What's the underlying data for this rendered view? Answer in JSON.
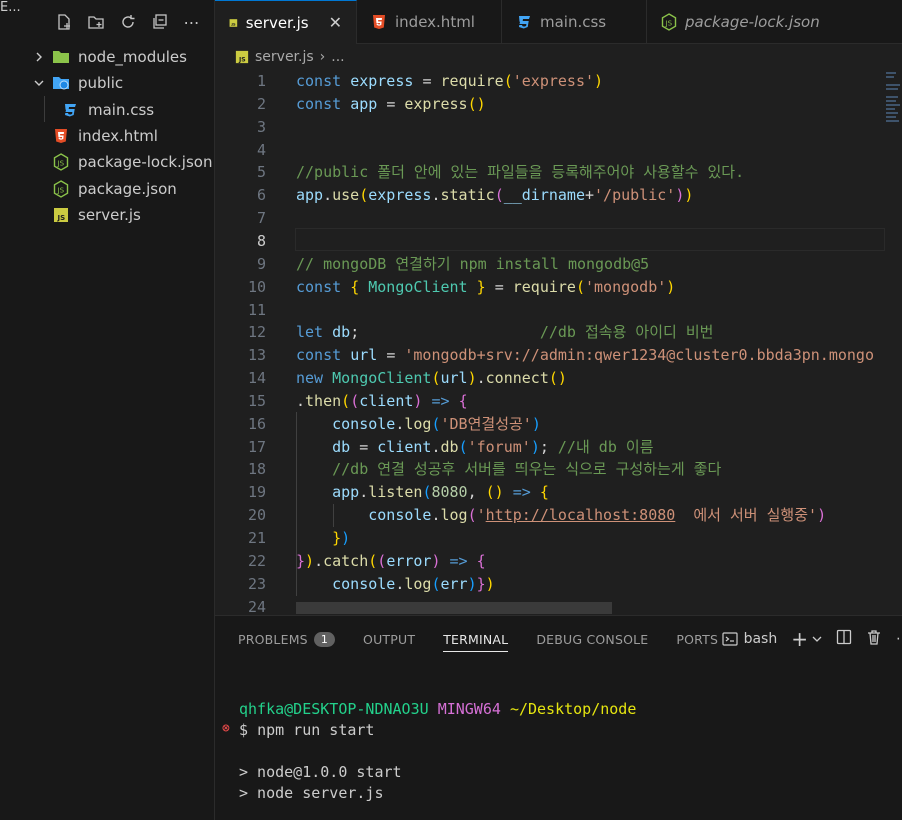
{
  "sidebar": {
    "title": "E...",
    "tree": [
      {
        "label": "node_modules",
        "type": "folder",
        "expanded": false
      },
      {
        "label": "public",
        "type": "folder",
        "expanded": true
      },
      {
        "label": "main.css",
        "type": "css"
      },
      {
        "label": "index.html",
        "type": "html"
      },
      {
        "label": "package-lock.json",
        "type": "json"
      },
      {
        "label": "package.json",
        "type": "json"
      },
      {
        "label": "server.js",
        "type": "js"
      }
    ]
  },
  "tabs": [
    {
      "label": "server.js",
      "active": true
    },
    {
      "label": "index.html",
      "active": false
    },
    {
      "label": "main.css",
      "active": false
    },
    {
      "label": "package-lock.json",
      "active": false
    }
  ],
  "breadcrumb": {
    "file": "server.js",
    "rest": "..."
  },
  "editor": {
    "current_line": 8,
    "lines": [
      {
        "n": "1",
        "tokens": [
          [
            "k",
            "const "
          ],
          [
            "v",
            "express "
          ],
          [
            "p",
            "= "
          ],
          [
            "f",
            "require"
          ],
          [
            "b1",
            "("
          ],
          [
            "s",
            "'express'"
          ],
          [
            "b1",
            ")"
          ]
        ]
      },
      {
        "n": "2",
        "tokens": [
          [
            "k",
            "const "
          ],
          [
            "v",
            "app "
          ],
          [
            "p",
            "= "
          ],
          [
            "f",
            "express"
          ],
          [
            "b1",
            "()"
          ]
        ]
      },
      {
        "n": "3",
        "tokens": []
      },
      {
        "n": "4",
        "tokens": []
      },
      {
        "n": "5",
        "tokens": [
          [
            "c",
            "//public 폴더 안에 있는 파일들을 등록해주어야 사용할수 있다."
          ]
        ]
      },
      {
        "n": "6",
        "tokens": [
          [
            "v",
            "app"
          ],
          [
            "p",
            "."
          ],
          [
            "f",
            "use"
          ],
          [
            "b1",
            "("
          ],
          [
            "v",
            "express"
          ],
          [
            "p",
            "."
          ],
          [
            "f",
            "static"
          ],
          [
            "b2",
            "("
          ],
          [
            "v",
            "__dirname"
          ],
          [
            "p",
            "+"
          ],
          [
            "s",
            "'/public'"
          ],
          [
            "b2",
            ")"
          ],
          [
            "b1",
            ")"
          ]
        ]
      },
      {
        "n": "7",
        "tokens": []
      },
      {
        "n": "8",
        "tokens": []
      },
      {
        "n": "9",
        "tokens": [
          [
            "c",
            "// mongoDB 연결하기 npm install mongodb@5"
          ]
        ]
      },
      {
        "n": "10",
        "tokens": [
          [
            "k",
            "const "
          ],
          [
            "b1",
            "{ "
          ],
          [
            "t",
            "MongoClient "
          ],
          [
            "b1",
            "} "
          ],
          [
            "p",
            "= "
          ],
          [
            "f",
            "require"
          ],
          [
            "b1",
            "("
          ],
          [
            "s",
            "'mongodb'"
          ],
          [
            "b1",
            ")"
          ]
        ]
      },
      {
        "n": "11",
        "tokens": []
      },
      {
        "n": "12",
        "tokens": [
          [
            "k",
            "let "
          ],
          [
            "v",
            "db"
          ],
          [
            "p",
            ";                    "
          ],
          [
            "c",
            "//db 접속용 아이디 비번"
          ]
        ]
      },
      {
        "n": "13",
        "tokens": [
          [
            "k",
            "const "
          ],
          [
            "v",
            "url "
          ],
          [
            "p",
            "= "
          ],
          [
            "s",
            "'mongodb+srv://admin:qwer1234@cluster0.bbda3pn.mongo"
          ]
        ]
      },
      {
        "n": "14",
        "tokens": [
          [
            "k",
            "new "
          ],
          [
            "t",
            "MongoClient"
          ],
          [
            "b1",
            "("
          ],
          [
            "v",
            "url"
          ],
          [
            "b1",
            ")"
          ],
          [
            "p",
            "."
          ],
          [
            "f",
            "connect"
          ],
          [
            "b1",
            "()"
          ]
        ]
      },
      {
        "n": "15",
        "tokens": [
          [
            "p",
            "."
          ],
          [
            "f",
            "then"
          ],
          [
            "b1",
            "("
          ],
          [
            "b2",
            "("
          ],
          [
            "v",
            "client"
          ],
          [
            "b2",
            ") "
          ],
          [
            "k",
            "=> "
          ],
          [
            "b2",
            "{"
          ]
        ]
      },
      {
        "n": "16",
        "tokens": [
          [
            "p",
            "    "
          ],
          [
            "v",
            "console"
          ],
          [
            "p",
            "."
          ],
          [
            "f",
            "log"
          ],
          [
            "b3",
            "("
          ],
          [
            "s",
            "'DB연결성공'"
          ],
          [
            "b3",
            ")"
          ]
        ]
      },
      {
        "n": "17",
        "tokens": [
          [
            "p",
            "    "
          ],
          [
            "v",
            "db "
          ],
          [
            "p",
            "= "
          ],
          [
            "v",
            "client"
          ],
          [
            "p",
            "."
          ],
          [
            "f",
            "db"
          ],
          [
            "b3",
            "("
          ],
          [
            "s",
            "'forum'"
          ],
          [
            "b3",
            ")"
          ],
          [
            "p",
            "; "
          ],
          [
            "c",
            "//내 db 이름"
          ]
        ]
      },
      {
        "n": "18",
        "tokens": [
          [
            "p",
            "    "
          ],
          [
            "c",
            "//db 연결 성공후 서버를 띄우는 식으로 구성하는게 좋다"
          ]
        ]
      },
      {
        "n": "19",
        "tokens": [
          [
            "p",
            "    "
          ],
          [
            "v",
            "app"
          ],
          [
            "p",
            "."
          ],
          [
            "f",
            "listen"
          ],
          [
            "b3",
            "("
          ],
          [
            "n",
            "8080"
          ],
          [
            "p",
            ", "
          ],
          [
            "b1",
            "() "
          ],
          [
            "k",
            "=> "
          ],
          [
            "b1",
            "{"
          ]
        ]
      },
      {
        "n": "20",
        "tokens": [
          [
            "p",
            "        "
          ],
          [
            "v",
            "console"
          ],
          [
            "p",
            "."
          ],
          [
            "f",
            "log"
          ],
          [
            "b2",
            "("
          ],
          [
            "s",
            "'"
          ],
          [
            "su",
            "http://localhost:8080"
          ],
          [
            "s",
            "  에서 서버 실행중'"
          ],
          [
            "b2",
            ")"
          ]
        ]
      },
      {
        "n": "21",
        "tokens": [
          [
            "p",
            "    "
          ],
          [
            "b1",
            "}"
          ],
          [
            "b3",
            ")"
          ]
        ]
      },
      {
        "n": "22",
        "tokens": [
          [
            "b2",
            "}"
          ],
          [
            "b1",
            ")"
          ],
          [
            "p",
            "."
          ],
          [
            "f",
            "catch"
          ],
          [
            "b1",
            "("
          ],
          [
            "b2",
            "("
          ],
          [
            "v",
            "error"
          ],
          [
            "b2",
            ") "
          ],
          [
            "k",
            "=> "
          ],
          [
            "b2",
            "{"
          ]
        ]
      },
      {
        "n": "23",
        "tokens": [
          [
            "p",
            "    "
          ],
          [
            "v",
            "console"
          ],
          [
            "p",
            "."
          ],
          [
            "f",
            "log"
          ],
          [
            "b3",
            "("
          ],
          [
            "v",
            "err"
          ],
          [
            "b3",
            ")"
          ],
          [
            "b2",
            "}"
          ],
          [
            "b1",
            ")"
          ]
        ]
      },
      {
        "n": "24",
        "tokens": []
      }
    ]
  },
  "panel": {
    "tabs": [
      {
        "label": "PROBLEMS",
        "badge": "1"
      },
      {
        "label": "OUTPUT"
      },
      {
        "label": "TERMINAL",
        "active": true
      },
      {
        "label": "DEBUG CONSOLE"
      },
      {
        "label": "PORTS"
      }
    ],
    "shell": "bash",
    "terminal": {
      "user_host": "qhfka@DESKTOP-NDNAO3U",
      "env": "MINGW64",
      "path": "~/Desktop/node",
      "prompt": "$",
      "command": "npm run start",
      "out1": "> node@1.0.0 start",
      "out2": "> node server.js"
    }
  },
  "colors": {
    "accent": "#0078d4",
    "js_icon": "#cbcb41",
    "html_icon": "#e44d26",
    "css_icon": "#42a5f5",
    "json_icon": "#8bc34a"
  }
}
